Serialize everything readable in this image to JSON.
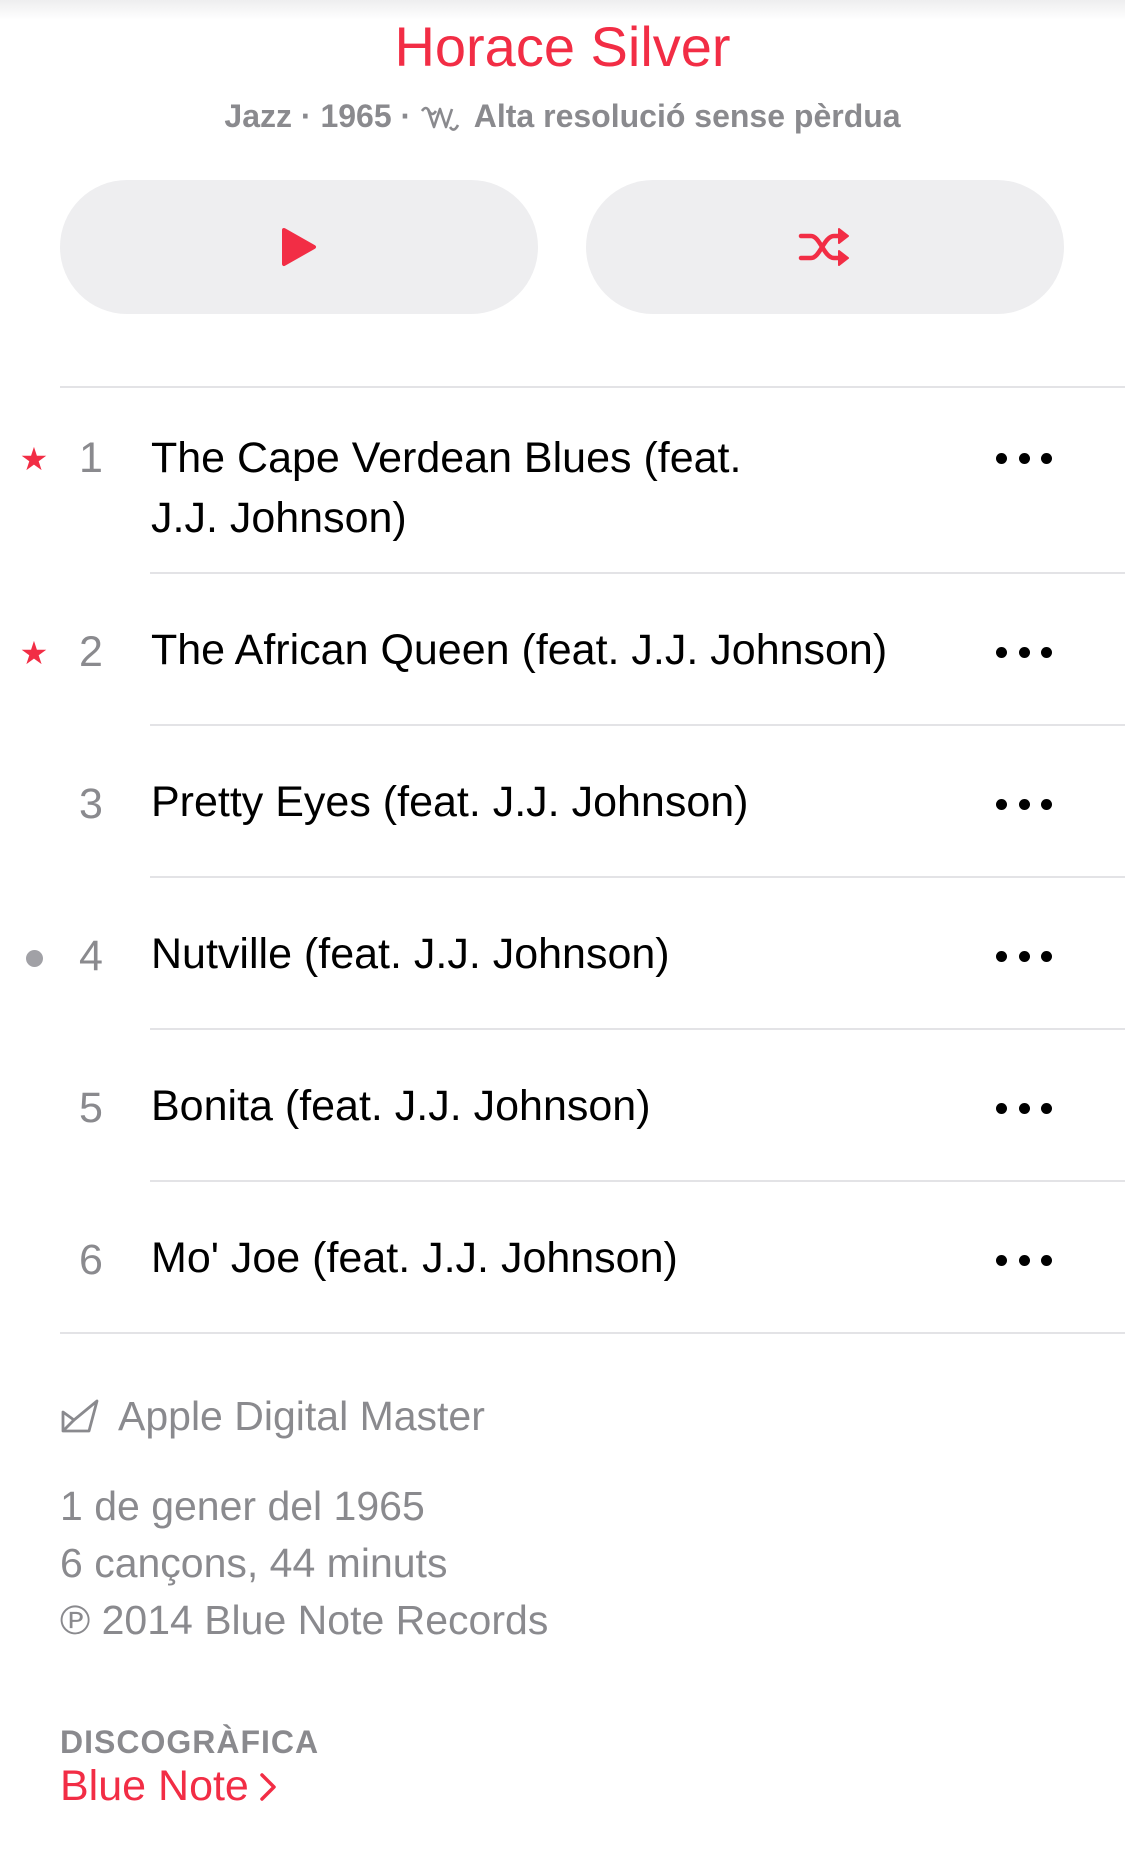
{
  "album": {
    "artist": "Horace Silver",
    "genre": "Jazz",
    "year": "1965",
    "separator": "·",
    "quality": "Alta resolució sense pèrdua",
    "accent_color": "#f22d45"
  },
  "actions": {
    "play_icon": "play-icon",
    "shuffle_icon": "shuffle-icon"
  },
  "tracks": [
    {
      "number": "1",
      "title_line1": "The Cape Verdean Blues (feat.",
      "title_line2": "J.J. Johnson)",
      "marker": "★"
    },
    {
      "number": "2",
      "title_line1": "The African Queen (feat. J.J. Johnson)",
      "marker": "★"
    },
    {
      "number": "3",
      "title_line1": "Pretty Eyes (feat. J.J. Johnson)",
      "marker": ""
    },
    {
      "number": "4",
      "title_line1": "Nutville (feat. J.J. Johnson)",
      "marker": "dot"
    },
    {
      "number": "5",
      "title_line1": "Bonita (feat. J.J. Johnson)",
      "marker": ""
    },
    {
      "number": "6",
      "title_line1": "Mo' Joe (feat. J.J. Johnson)",
      "marker": ""
    }
  ],
  "footer": {
    "badge": "Apple Digital Master",
    "release_date": "1 de gener del 1965",
    "summary": "6 cançons, 44 minuts",
    "copyright": "℗ 2014 Blue Note Records",
    "label_heading": "DISCOGRÀFICA",
    "label_name": "Blue Note"
  }
}
